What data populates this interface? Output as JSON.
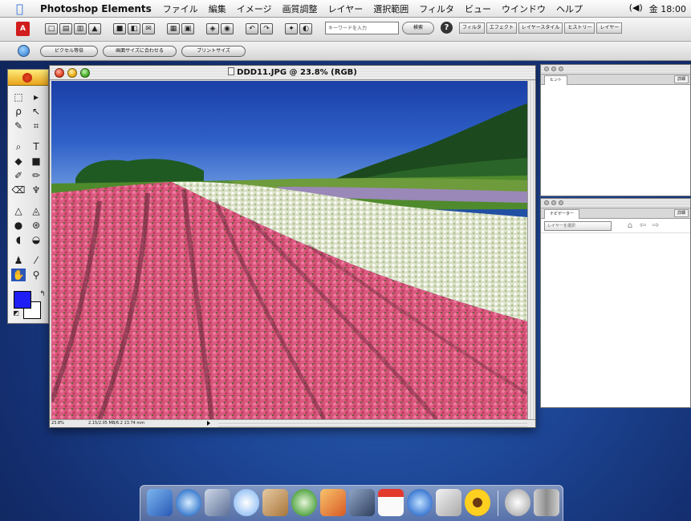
{
  "menubar": {
    "app_name": "Photoshop Elements",
    "items": [
      "ファイル",
      "編集",
      "イメージ",
      "画質調整",
      "レイヤー",
      "選択範囲",
      "フィルタ",
      "ビュー",
      "ウインドウ",
      "ヘルプ"
    ],
    "status_icon": "(◀)",
    "clock": "金 18:00"
  },
  "options_bar": {
    "search_placeholder": "キーワードを入力",
    "search_button": "検索",
    "help_icon": "?",
    "palette_tabs": [
      "フィルタ",
      "エフェクト",
      "レイヤースタイル",
      "ヒストリー",
      "レイヤー"
    ]
  },
  "shortcuts_bar": {
    "buttons": [
      "ピクセル等倍",
      "画面サイズに合わせる",
      "プリントサイズ"
    ]
  },
  "document": {
    "title": "DDD11.JPG @ 23.8% (RGB)",
    "zoom": "23.8%",
    "size_info": "2.15/2.05 MB/6.2 13.74 mm"
  },
  "palettes": {
    "top": {
      "tab": "ヒント",
      "more": "詳細"
    },
    "bottom": {
      "tab": "ナビゲーター",
      "more": "詳細",
      "select_placeholder": "レイヤーを選択"
    }
  },
  "dock": {
    "icons": [
      "finder-icon",
      "safari-icon",
      "mail-icon",
      "ichat-icon",
      "address-book-icon",
      "itunes-icon",
      "iphoto-icon",
      "imovie-icon",
      "ical-icon",
      "quicktime-icon",
      "ichat-av-icon",
      "photoshop-elements-icon",
      "system-preferences-icon",
      "trash-icon"
    ]
  },
  "colors": {
    "foreground": "#1f1ff5",
    "background": "#ffffff",
    "accent": "#2f6fd6"
  }
}
